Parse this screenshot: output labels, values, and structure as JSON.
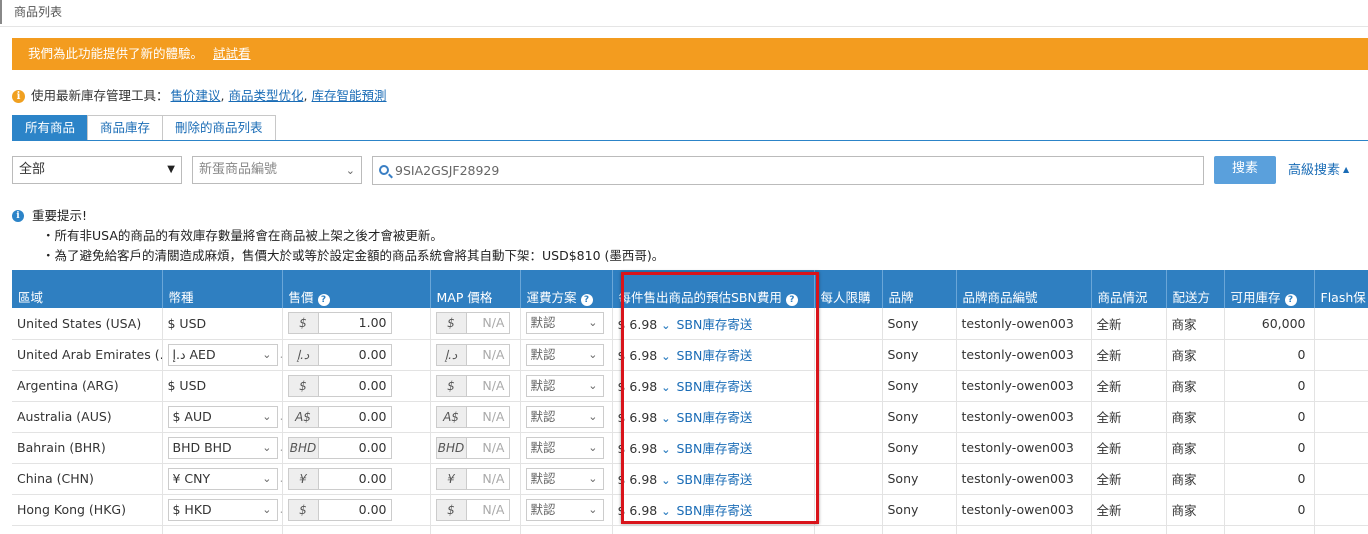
{
  "breadcrumb": "商品列表",
  "banner": {
    "text": "我們為此功能提供了新的體驗。",
    "link": "試試看"
  },
  "tools": {
    "prefix": "使用最新庫存管理工具：",
    "links": [
      "售价建议",
      "商品类型优化",
      "库存智能預測"
    ],
    "sep": ","
  },
  "tabs": [
    "所有商品",
    "商品庫存",
    "刪除的商品列表"
  ],
  "filters": {
    "scope": "全部",
    "field": "新蛋商品編號",
    "search_value": "9SIA2GSJF28929",
    "search_button": "搜素",
    "advanced": "高級搜素"
  },
  "notice": {
    "title": "重要提示!",
    "lines": [
      "・所有非USA的商品的有效庫存數量將會在商品被上架之後才會被更新。",
      "・為了避免給客戶的清關造成麻煩，售價大於或等於設定金額的商品系統會將其自動下架：USD$810 (墨西哥)。"
    ]
  },
  "table": {
    "headers": [
      "區域",
      "幣種",
      "售價",
      "MAP 價格",
      "運費方案",
      "每件售出商品的預估SBN費用",
      "每人限購",
      "品牌",
      "品牌商品編號",
      "商品情況",
      "配送方",
      "可用庫存",
      "Flash保"
    ],
    "rows": [
      {
        "region": "United States (USA)",
        "currency": "$ USD",
        "currency_select": false,
        "price_symbol": "$",
        "price": "1.00",
        "map_symbol": "$",
        "map": "N/A",
        "shipping": "默認",
        "fee": "$ 6.98",
        "fee_link": "SBN庫存寄送",
        "limit": "",
        "brand": "Sony",
        "brand_sku": "testonly-owen003",
        "condition": "全新",
        "fulfill": "商家",
        "stock": "60,000"
      },
      {
        "region": "United Arab Emirates (...",
        "currency": "د.إ AED",
        "currency_select": true,
        "price_symbol": "د.إ",
        "price": "0.00",
        "map_symbol": "د.إ",
        "map": "N/A",
        "shipping": "默認",
        "fee": "$ 6.98",
        "fee_link": "SBN庫存寄送",
        "limit": "",
        "brand": "Sony",
        "brand_sku": "testonly-owen003",
        "condition": "全新",
        "fulfill": "商家",
        "stock": "0"
      },
      {
        "region": "Argentina (ARG)",
        "currency": "$ USD",
        "currency_select": false,
        "price_symbol": "$",
        "price": "0.00",
        "map_symbol": "$",
        "map": "N/A",
        "shipping": "默認",
        "fee": "$ 6.98",
        "fee_link": "SBN庫存寄送",
        "limit": "",
        "brand": "Sony",
        "brand_sku": "testonly-owen003",
        "condition": "全新",
        "fulfill": "商家",
        "stock": "0"
      },
      {
        "region": "Australia (AUS)",
        "currency": "$ AUD",
        "currency_select": true,
        "price_symbol": "A$",
        "price": "0.00",
        "map_symbol": "A$",
        "map": "N/A",
        "shipping": "默認",
        "fee": "$ 6.98",
        "fee_link": "SBN庫存寄送",
        "limit": "",
        "brand": "Sony",
        "brand_sku": "testonly-owen003",
        "condition": "全新",
        "fulfill": "商家",
        "stock": "0"
      },
      {
        "region": "Bahrain (BHR)",
        "currency": "BHD BHD",
        "currency_select": true,
        "price_symbol": "BHD",
        "price": "0.00",
        "map_symbol": "BHD",
        "map": "N/A",
        "shipping": "默認",
        "fee": "$ 6.98",
        "fee_link": "SBN庫存寄送",
        "limit": "",
        "brand": "Sony",
        "brand_sku": "testonly-owen003",
        "condition": "全新",
        "fulfill": "商家",
        "stock": "0"
      },
      {
        "region": "China (CHN)",
        "currency": "¥ CNY",
        "currency_select": true,
        "price_symbol": "¥",
        "price": "0.00",
        "map_symbol": "¥",
        "map": "N/A",
        "shipping": "默認",
        "fee": "$ 6.98",
        "fee_link": "SBN庫存寄送",
        "limit": "",
        "brand": "Sony",
        "brand_sku": "testonly-owen003",
        "condition": "全新",
        "fulfill": "商家",
        "stock": "0"
      },
      {
        "region": "Hong Kong (HKG)",
        "currency": "$ HKD",
        "currency_select": true,
        "price_symbol": "$",
        "price": "0.00",
        "map_symbol": "$",
        "map": "N/A",
        "shipping": "默認",
        "fee": "$ 6.98",
        "fee_link": "SBN庫存寄送",
        "limit": "",
        "brand": "Sony",
        "brand_sku": "testonly-owen003",
        "condition": "全新",
        "fulfill": "商家",
        "stock": "0"
      }
    ]
  }
}
